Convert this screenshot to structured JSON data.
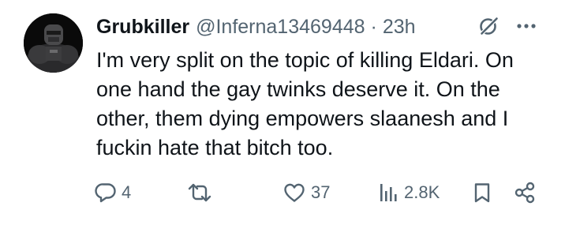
{
  "tweet": {
    "author": {
      "display_name": "Grubkiller",
      "handle": "@Inferna13469448",
      "avatar": "armored-warrior-avatar"
    },
    "separator": "·",
    "timestamp": "23h",
    "text": "I'm very split on the topic of killing Eldari. On one hand the gay twinks deserve it. On the other, them dying empowers slaanesh and I fuckin hate that bitch too.",
    "icons": {
      "grok": "grok-icon",
      "more": "more-icon"
    },
    "actions": {
      "reply": {
        "icon": "reply-icon",
        "count": "4"
      },
      "retweet": {
        "icon": "retweet-icon",
        "count": ""
      },
      "like": {
        "icon": "heart-icon",
        "count": "37"
      },
      "views": {
        "icon": "analytics-icon",
        "count": "2.8K"
      },
      "bookmark": {
        "icon": "bookmark-icon"
      },
      "share": {
        "icon": "share-icon"
      }
    }
  },
  "colors": {
    "primary_text": "#0f1419",
    "secondary_text": "#536471",
    "background": "#ffffff"
  }
}
